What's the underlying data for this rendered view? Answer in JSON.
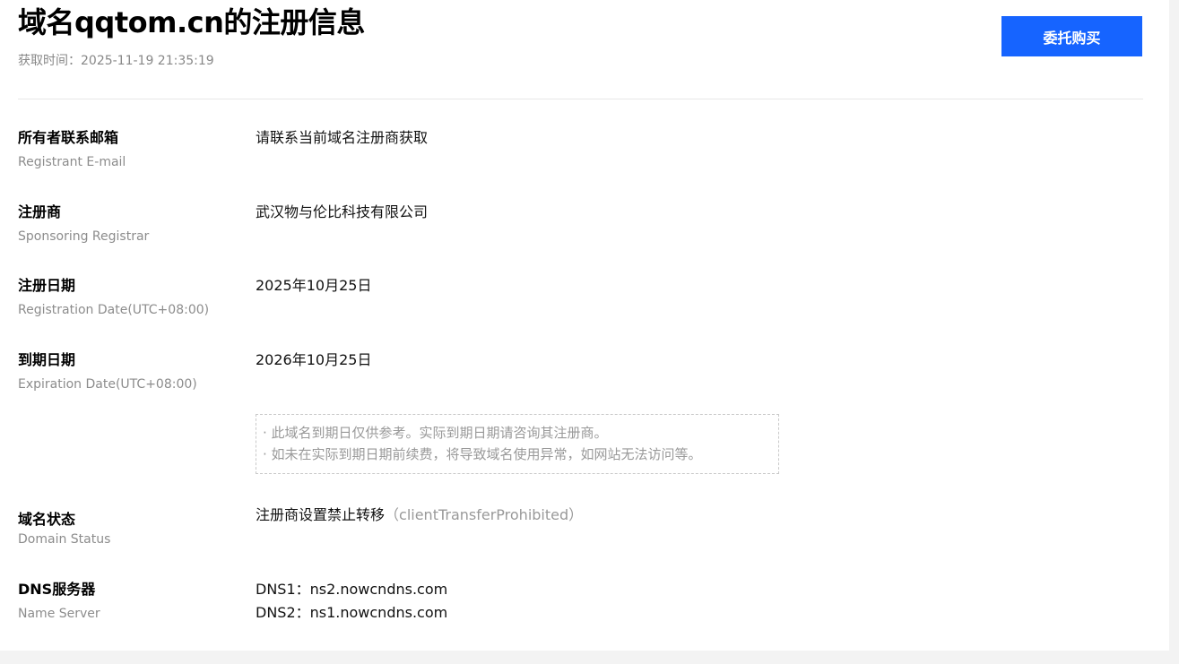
{
  "header": {
    "title": "域名qqtom.cn的注册信息",
    "fetch_time": "获取时间：2025-11-19 21:35:19",
    "buy_button": "委托购买"
  },
  "rows": {
    "email": {
      "label_cn": "所有者联系邮箱",
      "label_en": "Registrant E-mail",
      "value": "请联系当前域名注册商获取"
    },
    "registrar": {
      "label_cn": "注册商",
      "label_en": "Sponsoring Registrar",
      "value": "武汉物与伦比科技有限公司"
    },
    "registration": {
      "label_cn": "注册日期",
      "label_en": "Registration Date(UTC+08:00)",
      "value": "2025年10月25日"
    },
    "expiration": {
      "label_cn": "到期日期",
      "label_en": "Expiration Date(UTC+08:00)",
      "value": "2026年10月25日",
      "notes": [
        "· 此域名到期日仅供参考。实际到期日期请咨询其注册商。",
        "· 如未在实际到期日期前续费，将导致域名使用异常，如网站无法访问等。"
      ]
    },
    "status": {
      "label_cn": "域名状态",
      "label_en": "Domain Status",
      "value": "注册商设置禁止转移",
      "code": "（clientTransferProhibited）"
    },
    "dns": {
      "label_cn": "DNS服务器",
      "label_en": "Name Server",
      "servers": [
        "DNS1：ns2.nowcndns.com",
        "DNS2：ns1.nowcndns.com"
      ]
    }
  }
}
